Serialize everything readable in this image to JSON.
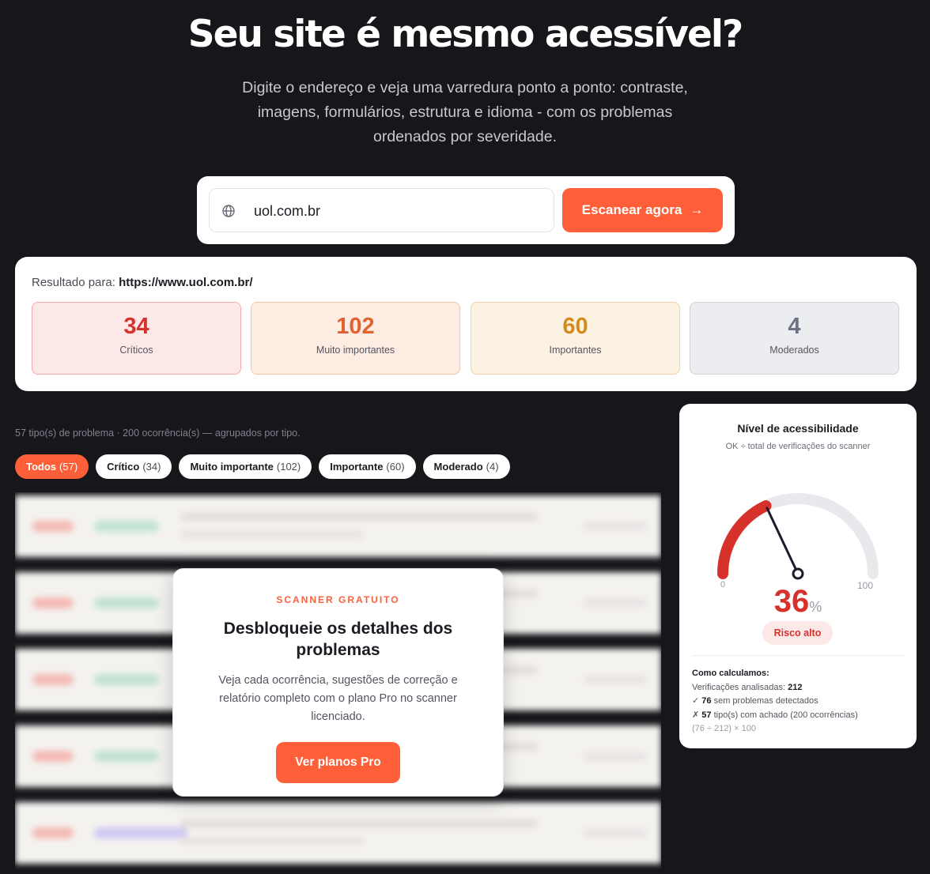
{
  "hero": {
    "title": "Seu site é mesmo acessível?",
    "subtitle": "Digite o endereço e veja uma varredura ponto a ponto: contraste, imagens, formulários, estrutura e idioma - com os problemas ordenados por severidade."
  },
  "scan": {
    "url_value": "uol.com.br",
    "button_label": "Escanear agora",
    "button_arrow": "→",
    "globe_icon": "globe-icon"
  },
  "result": {
    "label": "Resultado para:",
    "url": "https://www.uol.com.br/",
    "stats": [
      {
        "value": "34",
        "label": "Críticos",
        "color": "#d6322b"
      },
      {
        "value": "102",
        "label": "Muito importantes",
        "color": "#e0622e"
      },
      {
        "value": "60",
        "label": "Importantes",
        "color": "#d48a1c"
      },
      {
        "value": "4",
        "label": "Moderados",
        "color": "#6e7282"
      }
    ]
  },
  "summary": "57 tipo(s) de problema · 200 ocorrência(s) — agrupados por tipo.",
  "filters": [
    {
      "label": "Todos",
      "count": "(57)",
      "active": true
    },
    {
      "label": "Crítico",
      "count": "(34)",
      "active": false
    },
    {
      "label": "Muito importante",
      "count": "(102)",
      "active": false
    },
    {
      "label": "Importante",
      "count": "(60)",
      "active": false
    },
    {
      "label": "Moderado",
      "count": "(4)",
      "active": false
    }
  ],
  "unlock": {
    "kicker": "SCANNER GRATUITO",
    "title": "Desbloqueie os detalhes dos problemas",
    "description": "Veja cada ocorrência, sugestões de correção e relatório completo com o plano Pro no scanner licenciado.",
    "cta": "Ver planos Pro"
  },
  "gauge": {
    "title": "Nível de acessibilidade",
    "subtitle": "OK ÷ total de verificações do scanner",
    "value": 36,
    "value_text": "36",
    "unit": "%",
    "min": "0",
    "max": "100",
    "risk_label": "Risco alto",
    "colors": {
      "arc": "#d6322b",
      "track": "#e8e8ed",
      "needle": "#1b1b2a"
    },
    "calc": {
      "heading": "Como calculamos:",
      "checks_label": "Verificações analisadas:",
      "checks_value": "212",
      "ok_mark": "✓",
      "ok_value": "76",
      "ok_label": "sem problemas detectados",
      "fail_mark": "✗",
      "fail_value": "57",
      "fail_label": "tipo(s) com achado (200 ocorrências)",
      "formula": "(76 ÷ 212) × 100"
    }
  },
  "brand_color": "#ff5f38"
}
